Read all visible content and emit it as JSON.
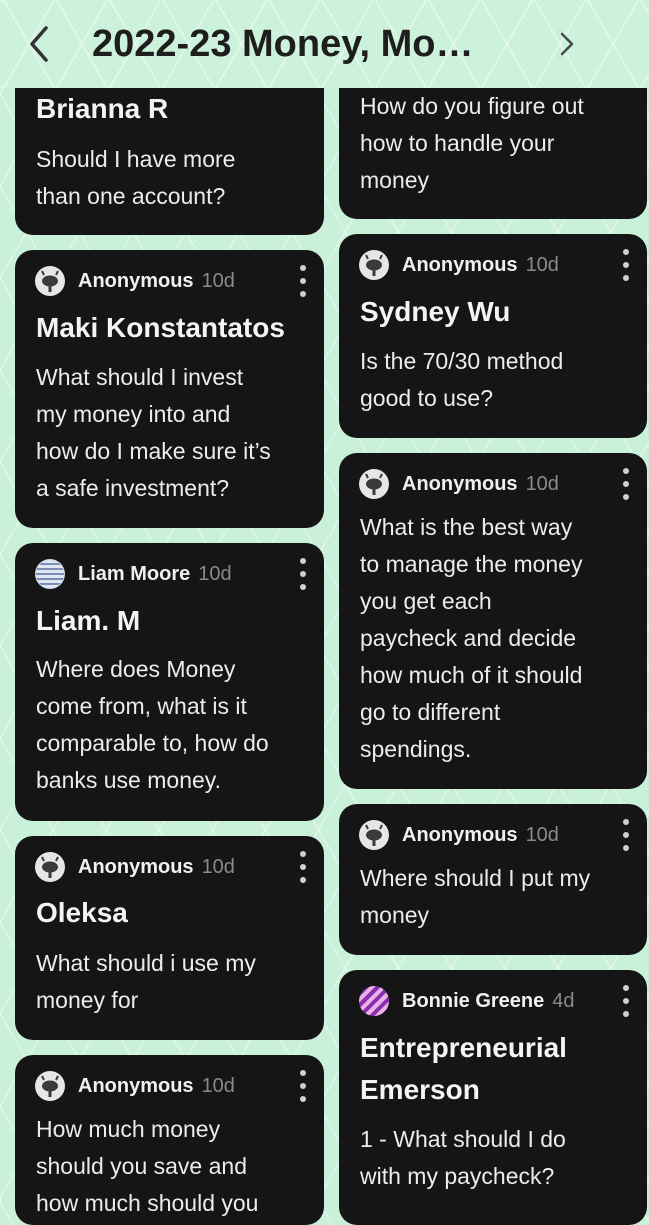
{
  "header": {
    "title": "2022-23 Money, Mo…",
    "back_icon": "chevron-left-icon",
    "forward_icon": "chevron-right-icon"
  },
  "posts": {
    "brianna": {
      "title": "Brianna R",
      "body": "Should I have more\nthan one account?"
    },
    "figure": {
      "body": "How do you figure out\nhow to handle your\nmoney"
    },
    "maki": {
      "author": "Anonymous",
      "ago": "10d",
      "title": "Maki Konstantatos",
      "body": "What should I invest\nmy money into and\nhow do I make sure it’s\na safe investment?"
    },
    "sydney": {
      "author": "Anonymous",
      "ago": "10d",
      "title": "Sydney Wu",
      "body": "Is the 70/30 method\ngood to use?"
    },
    "liam": {
      "author": "Liam Moore",
      "ago": "10d",
      "title": "Liam. M",
      "body": "Where does Money\ncome from, what is it\ncomparable to, how do\nbanks use money."
    },
    "manage": {
      "author": "Anonymous",
      "ago": "10d",
      "body": "What is the best way\nto manage the money\nyou get each\npaycheck and decide\nhow much of it should\ngo to different\nspendings."
    },
    "oleksa": {
      "author": "Anonymous",
      "ago": "10d",
      "title": "Oleksa",
      "body": "What should i use my\nmoney for"
    },
    "where": {
      "author": "Anonymous",
      "ago": "10d",
      "body": "Where should I put my\nmoney"
    },
    "save": {
      "author": "Anonymous",
      "ago": "10d",
      "body": "How much money\nshould you save and\nhow much should you"
    },
    "bonnie": {
      "author": "Bonnie Greene",
      "ago": "4d",
      "title": "Entrepreneurial\nEmerson",
      "body": "1 - What should I do\nwith my paycheck?"
    }
  },
  "colors": {
    "card_background": "#151515",
    "page_background": "#c9f0d8",
    "timestamp": "#8a8a8a"
  }
}
